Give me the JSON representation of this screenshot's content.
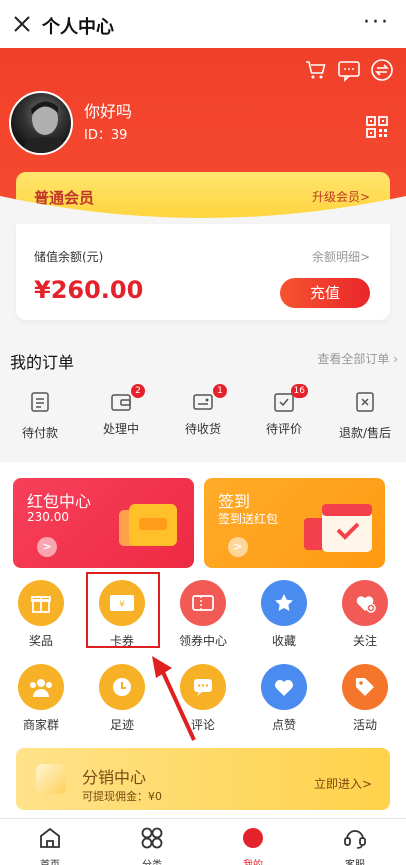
{
  "nav": {
    "title": "个人中心",
    "more": "···"
  },
  "user": {
    "nickname": "你好吗",
    "id": "ID：39"
  },
  "member": {
    "label": "普通会员",
    "upgrade": "升级会员>"
  },
  "balance": {
    "label": "储值余额(元)",
    "detail": "余额明细>",
    "amount": "¥260.00",
    "recharge": "充值"
  },
  "orders": {
    "title": "我的订单",
    "view_all": "查看全部订单",
    "items": [
      {
        "label": "待付款",
        "badge": "",
        "icon": "wallet-icon"
      },
      {
        "label": "处理中",
        "badge": "2",
        "icon": "card-icon"
      },
      {
        "label": "待收货",
        "badge": "1",
        "icon": "truck-icon"
      },
      {
        "label": "待评价",
        "badge": "16",
        "icon": "review-icon"
      },
      {
        "label": "退款/售后",
        "badge": "",
        "icon": "refund-icon"
      }
    ]
  },
  "cards": {
    "redpack": {
      "title": "红包中心",
      "value": "230.00"
    },
    "signin": {
      "title": "签到",
      "subtitle": "签到送红包"
    }
  },
  "grid": [
    {
      "label": "奖品",
      "icon": "gift-icon",
      "color": "#f7b126"
    },
    {
      "label": "卡券",
      "icon": "coupon-icon",
      "color": "#f7b126"
    },
    {
      "label": "领券中心",
      "icon": "ticket-icon",
      "color": "#f15a55"
    },
    {
      "label": "收藏",
      "icon": "star-icon",
      "color": "#4a8bef"
    },
    {
      "label": "关注",
      "icon": "heart-plus-icon",
      "color": "#f15a55"
    },
    {
      "label": "商家群",
      "icon": "group-icon",
      "color": "#f7b126"
    },
    {
      "label": "足迹",
      "icon": "clock-icon",
      "color": "#f7b126"
    },
    {
      "label": "评论",
      "icon": "comment-icon",
      "color": "#f7b126"
    },
    {
      "label": "点赞",
      "icon": "like-icon",
      "color": "#4a8bef"
    },
    {
      "label": "活动",
      "icon": "tag-icon",
      "color": "#f5752a"
    }
  ],
  "distribution": {
    "title": "分销中心",
    "commission": "可提现佣金：¥0",
    "enter": "立即进入>"
  },
  "tabbar": [
    {
      "label": "首页",
      "icon": "home-icon"
    },
    {
      "label": "分类",
      "icon": "category-icon"
    },
    {
      "label": "我的",
      "icon": "me-icon"
    },
    {
      "label": "客服",
      "icon": "service-icon"
    }
  ],
  "colors": {
    "primary_red": "#e4222b",
    "header_red": "#f0402a",
    "gold": "#ffd338"
  }
}
